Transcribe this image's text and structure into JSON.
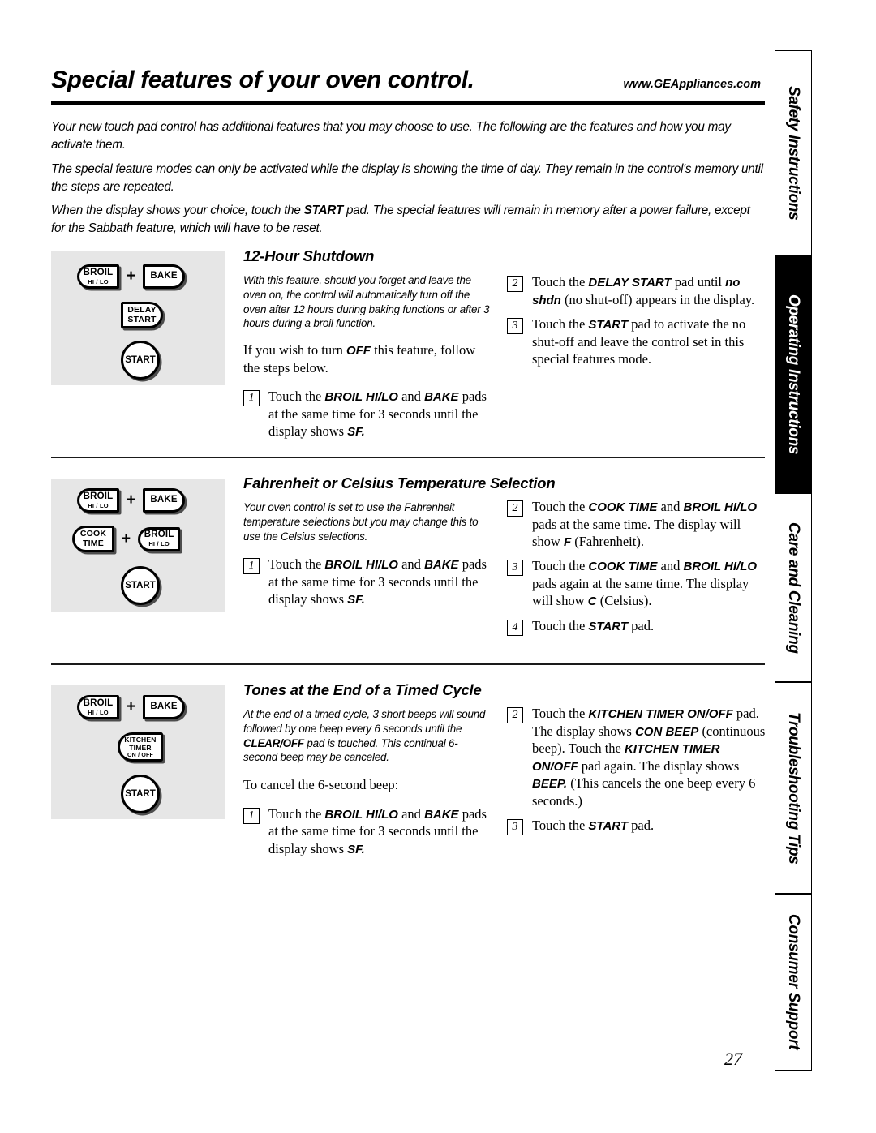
{
  "header": {
    "title": "Special features of your oven control.",
    "url": "www.GEAppliances.com"
  },
  "intro": {
    "p1_a": "Your new touch pad control has additional features that you may choose to use. The following are the features and how you may activate them.",
    "p2_a": "The special feature modes can only be activated while the display is showing the time of day. They remain in the control's memory until the steps are repeated.",
    "p3_a": "When the display shows your choice, touch the ",
    "p3_b": "START",
    "p3_c": " pad. The special features will remain in memory after a power failure, except for the Sabbath feature, which will have to be reset."
  },
  "sections": [
    {
      "heading": "12-Hour Shutdown",
      "pads": [
        {
          "label_l1": "BROIL",
          "label_l2": "HI / LO",
          "shape": "round-left"
        },
        {
          "plus": "+"
        },
        {
          "label_l1": "BAKE",
          "shape": "round-right"
        },
        {
          "label_l1": "DELAY",
          "label_l2": "START",
          "shape": "round-right"
        },
        {
          "label_l1": "START",
          "shape": "circle"
        }
      ],
      "note": "With this feature, should you forget and leave the oven on, the control will automatically turn off the oven after 12 hours during baking functions or after 3 hours during a broil function.",
      "para_a": "If you wish to turn ",
      "para_b": "OFF",
      "para_c": " this feature, follow the steps below.",
      "steps_left": [
        {
          "num": "1",
          "a": "Touch the ",
          "b1": "BROIL HI/LO",
          "c": " and ",
          "b2": "BAKE",
          "d": " pads at the same time for 3 seconds until the display shows ",
          "b3": "SF.",
          "e": ""
        }
      ],
      "steps_right": [
        {
          "num": "2",
          "a": "Touch the ",
          "b1": "DELAY START",
          "c": " pad until ",
          "b2": "no shdn",
          "d": " (no shut-off) appears in the display.",
          "b3": "",
          "e": ""
        },
        {
          "num": "3",
          "a": "Touch the ",
          "b1": "START",
          "c": " pad to activate the no shut-off and leave the control set in this special features mode.",
          "b2": "",
          "d": "",
          "b3": "",
          "e": ""
        }
      ]
    },
    {
      "heading": "Fahrenheit or Celsius Temperature Selection",
      "pads": [
        {
          "label_l1": "BROIL",
          "label_l2": "HI / LO",
          "shape": "round-left"
        },
        {
          "plus": "+"
        },
        {
          "label_l1": "BAKE",
          "shape": "round-right"
        },
        {
          "label_l1": "COOK",
          "label_l2": "TIME",
          "shape": "round-left"
        },
        {
          "plus": "+"
        },
        {
          "label_l1": "BROIL",
          "label_l2": "HI / LO",
          "shape": "round-left"
        },
        {
          "label_l1": "START",
          "shape": "circle"
        }
      ],
      "note": "Your oven control is set to use the Fahrenheit temperature selections but you may change this to use the Celsius selections.",
      "para_a": "",
      "para_b": "",
      "para_c": "",
      "steps_left": [
        {
          "num": "1",
          "a": "Touch the ",
          "b1": "BROIL HI/LO",
          "c": " and ",
          "b2": "BAKE",
          "d": " pads at the same time for 3 seconds until the display shows ",
          "b3": "SF.",
          "e": ""
        }
      ],
      "steps_right": [
        {
          "num": "2",
          "a": "Touch the ",
          "b1": "COOK TIME",
          "c": " and ",
          "b2": "BROIL HI/LO",
          "d": " pads at the same time. The display will show ",
          "b3": "F",
          "e": " (Fahrenheit)."
        },
        {
          "num": "3",
          "a": "Touch the ",
          "b1": "COOK TIME",
          "c": " and ",
          "b2": "BROIL HI/LO",
          "d": " pads again at the same time. The display will show ",
          "b3": "C",
          "e": " (Celsius)."
        },
        {
          "num": "4",
          "a": "Touch the ",
          "b1": "START",
          "c": " pad.",
          "b2": "",
          "d": "",
          "b3": "",
          "e": ""
        }
      ]
    },
    {
      "heading": "Tones at the End of a Timed Cycle",
      "pads": [
        {
          "label_l1": "BROIL",
          "label_l2": "HI / LO",
          "shape": "round-left"
        },
        {
          "plus": "+"
        },
        {
          "label_l1": "BAKE",
          "shape": "round-right"
        },
        {
          "label_l1": "KITCHEN",
          "label_l2": "TIMER",
          "label_l3": "ON / OFF",
          "shape": "round-left"
        },
        {
          "label_l1": "START",
          "shape": "circle"
        }
      ],
      "note_a": "At the end of a timed cycle, 3 short beeps will sound followed by one beep every 6 seconds until the ",
      "note_b": "CLEAR/OFF",
      "note_c": " pad is touched. This continual 6-second beep may be canceled.",
      "para_a": "To cancel the 6-second beep:",
      "para_b": "",
      "para_c": "",
      "steps_left": [
        {
          "num": "1",
          "a": "Touch the ",
          "b1": "BROIL HI/LO",
          "c": " and ",
          "b2": "BAKE",
          "d": " pads at the same time for 3 seconds until the display shows ",
          "b3": "SF.",
          "e": ""
        }
      ],
      "steps_right": [
        {
          "num": "2",
          "a": "Touch the ",
          "b1": "KITCHEN TIMER ON/OFF",
          "c": " pad. The display shows ",
          "b2": "CON BEEP",
          "d": " (continuous beep). Touch the ",
          "b3": "KITCHEN TIMER ON/OFF",
          "e": " pad again. The display shows ",
          "b4": "BEEP.",
          "f": " (This cancels the one beep every 6 seconds.)"
        },
        {
          "num": "3",
          "a": "Touch the ",
          "b1": "START",
          "c": " pad.",
          "b2": "",
          "d": "",
          "b3": "",
          "e": ""
        }
      ]
    }
  ],
  "tabs": [
    {
      "label": "Safety Instructions",
      "active": false
    },
    {
      "label": "Operating Instructions",
      "active": true
    },
    {
      "label": "Care and Cleaning",
      "active": false
    },
    {
      "label": "Troubleshooting Tips",
      "active": false
    },
    {
      "label": "Consumer Support",
      "active": false
    }
  ],
  "page_number": "27"
}
